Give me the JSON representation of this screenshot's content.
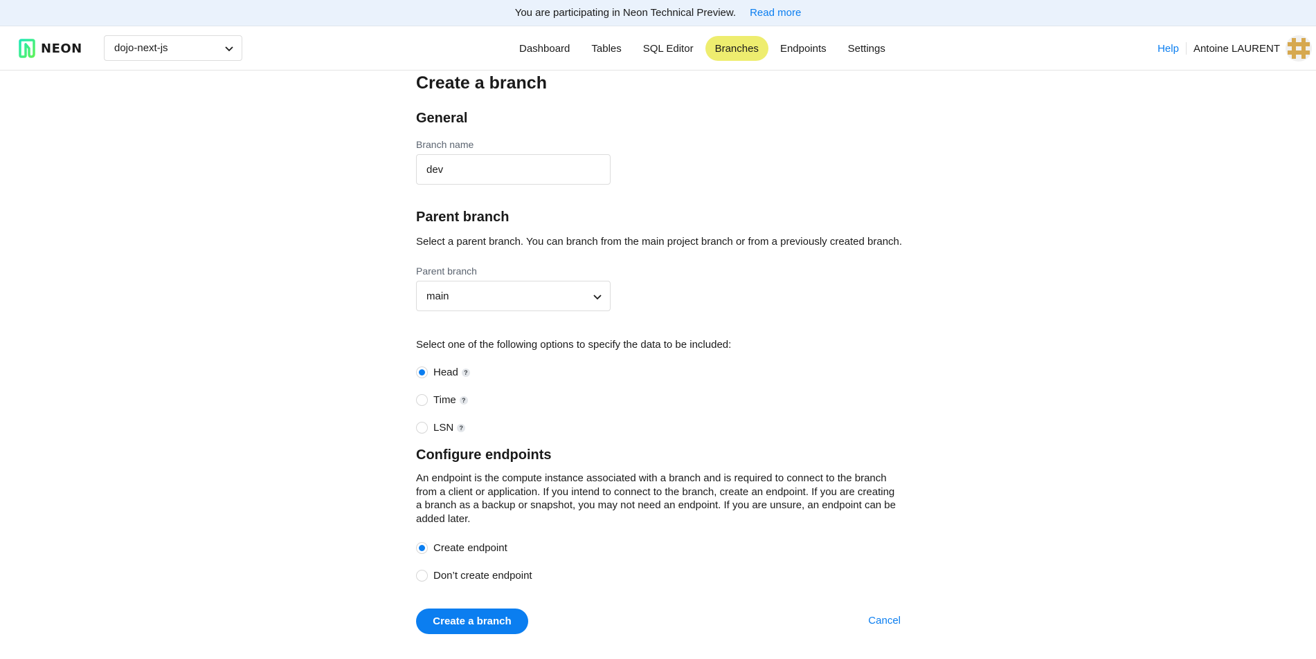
{
  "banner": {
    "message": "You are participating in Neon Technical Preview.",
    "link": "Read more"
  },
  "header": {
    "logo_text": "NEON",
    "project": "dojo-next-js",
    "nav": [
      {
        "label": "Dashboard",
        "active": false
      },
      {
        "label": "Tables",
        "active": false
      },
      {
        "label": "SQL Editor",
        "active": false
      },
      {
        "label": "Branches",
        "active": true
      },
      {
        "label": "Endpoints",
        "active": false
      },
      {
        "label": "Settings",
        "active": false
      }
    ],
    "help": "Help",
    "user_name": "Antoine LAURENT"
  },
  "page": {
    "title": "Create a branch",
    "general": {
      "heading": "General",
      "branch_name_label": "Branch name",
      "branch_name_value": "dev"
    },
    "parent": {
      "heading": "Parent branch",
      "description": "Select a parent branch. You can branch from the main project branch or from a previously created branch.",
      "select_label": "Parent branch",
      "selected": "main",
      "options_prompt": "Select one of the following options to specify the data to be included:",
      "options": [
        {
          "label": "Head",
          "checked": true,
          "help": "?"
        },
        {
          "label": "Time",
          "checked": false,
          "help": "?"
        },
        {
          "label": "LSN",
          "checked": false,
          "help": "?"
        }
      ]
    },
    "endpoints": {
      "heading": "Configure endpoints",
      "description": "An endpoint is the compute instance associated with a branch and is required to connect to the branch from a client or application. If you intend to connect to the branch, create an endpoint. If you are creating a branch as a backup or snapshot, you may not need an endpoint. If you are unsure, an endpoint can be added later.",
      "options": [
        {
          "label": "Create endpoint",
          "checked": true
        },
        {
          "label": "Don’t create endpoint",
          "checked": false
        }
      ]
    },
    "actions": {
      "submit": "Create a branch",
      "cancel": "Cancel"
    }
  },
  "colors": {
    "accent": "#0b7ef0",
    "nav_active": "#eeed6f",
    "banner_bg": "#eaf2fc"
  }
}
